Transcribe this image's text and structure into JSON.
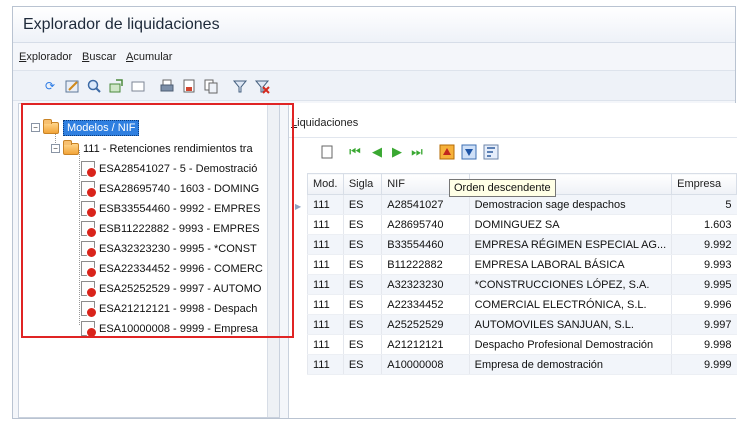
{
  "window": {
    "title": "Explorador de liquidaciones"
  },
  "menu": {
    "items": [
      {
        "label_hot": "E",
        "label_rest": "xplorador"
      },
      {
        "label_hot": "B",
        "label_rest": "uscar"
      },
      {
        "label_hot": "A",
        "label_rest": "cumular"
      }
    ]
  },
  "toolbar": {
    "icons": [
      "refresh-icon",
      "edit-icon",
      "search-icon",
      "export-icon",
      "blank-icon",
      "print-icon",
      "print-preview-icon",
      "copy-icon",
      "filter-icon",
      "clear-filter-icon"
    ]
  },
  "tree": {
    "root": {
      "label": "Modelos / NIF"
    },
    "model": {
      "label": "111 - Retenciones rendimientos tra"
    },
    "items": [
      {
        "label": "ESA28541027 - 5 - Demostració"
      },
      {
        "label": "ESA28695740 - 1603 - DOMING"
      },
      {
        "label": "ESB33554460 - 9992 - EMPRES"
      },
      {
        "label": "ESB11222882 - 9993 - EMPRES"
      },
      {
        "label": "ESA32323230 - 9995 - *CONST"
      },
      {
        "label": "ESA22334452 - 9996 - COMERC"
      },
      {
        "label": "ESA25252529 - 9997 - AUTOMO"
      },
      {
        "label": "ESA21212121 - 9998 - Despach"
      },
      {
        "label": "ESA10000008 - 9999 - Empresa"
      }
    ]
  },
  "grid": {
    "caption_hot": "L",
    "caption_rest": "iquidaciones",
    "tooltip": "Orden descendente",
    "columns": [
      "Mod.",
      "Sigla",
      "NIF",
      "",
      "Empresa"
    ],
    "rows": [
      [
        "111",
        "ES",
        "A28541027",
        "Demostracion sage despachos",
        "5"
      ],
      [
        "111",
        "ES",
        "A28695740",
        "DOMINGUEZ SA",
        "1.603"
      ],
      [
        "111",
        "ES",
        "B33554460",
        "EMPRESA RÉGIMEN ESPECIAL AG...",
        "9.992"
      ],
      [
        "111",
        "ES",
        "B11222882",
        "EMPRESA LABORAL BÁSICA",
        "9.993"
      ],
      [
        "111",
        "ES",
        "A32323230",
        "*CONSTRUCCIONES LÓPEZ, S.A.",
        "9.995"
      ],
      [
        "111",
        "ES",
        "A22334452",
        "COMERCIAL ELECTRÓNICA, S.L.",
        "9.996"
      ],
      [
        "111",
        "ES",
        "A25252529",
        "AUTOMOVILES SANJUAN, S.L.",
        "9.997"
      ],
      [
        "111",
        "ES",
        "A21212121",
        "Despacho Profesional Demostración",
        "9.998"
      ],
      [
        "111",
        "ES",
        "A10000008",
        "Empresa de demostración",
        "9.999"
      ]
    ]
  },
  "colors": {
    "highlight": "#e02424",
    "selection": "#2f7fe0"
  }
}
